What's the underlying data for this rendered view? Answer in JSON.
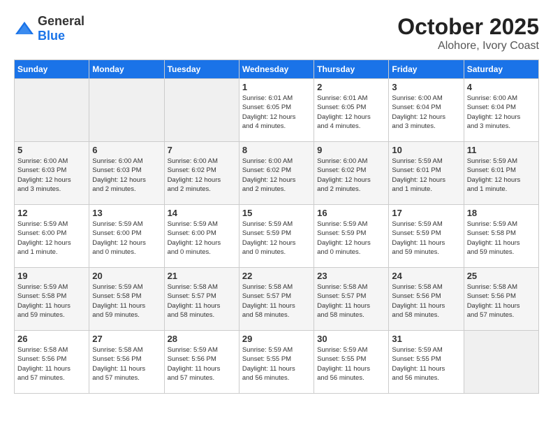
{
  "header": {
    "logo_general": "General",
    "logo_blue": "Blue",
    "month": "October 2025",
    "location": "Alohore, Ivory Coast"
  },
  "days_of_week": [
    "Sunday",
    "Monday",
    "Tuesday",
    "Wednesday",
    "Thursday",
    "Friday",
    "Saturday"
  ],
  "weeks": [
    [
      {
        "day": "",
        "info": ""
      },
      {
        "day": "",
        "info": ""
      },
      {
        "day": "",
        "info": ""
      },
      {
        "day": "1",
        "info": "Sunrise: 6:01 AM\nSunset: 6:05 PM\nDaylight: 12 hours\nand 4 minutes."
      },
      {
        "day": "2",
        "info": "Sunrise: 6:01 AM\nSunset: 6:05 PM\nDaylight: 12 hours\nand 4 minutes."
      },
      {
        "day": "3",
        "info": "Sunrise: 6:00 AM\nSunset: 6:04 PM\nDaylight: 12 hours\nand 3 minutes."
      },
      {
        "day": "4",
        "info": "Sunrise: 6:00 AM\nSunset: 6:04 PM\nDaylight: 12 hours\nand 3 minutes."
      }
    ],
    [
      {
        "day": "5",
        "info": "Sunrise: 6:00 AM\nSunset: 6:03 PM\nDaylight: 12 hours\nand 3 minutes."
      },
      {
        "day": "6",
        "info": "Sunrise: 6:00 AM\nSunset: 6:03 PM\nDaylight: 12 hours\nand 2 minutes."
      },
      {
        "day": "7",
        "info": "Sunrise: 6:00 AM\nSunset: 6:02 PM\nDaylight: 12 hours\nand 2 minutes."
      },
      {
        "day": "8",
        "info": "Sunrise: 6:00 AM\nSunset: 6:02 PM\nDaylight: 12 hours\nand 2 minutes."
      },
      {
        "day": "9",
        "info": "Sunrise: 6:00 AM\nSunset: 6:02 PM\nDaylight: 12 hours\nand 2 minutes."
      },
      {
        "day": "10",
        "info": "Sunrise: 5:59 AM\nSunset: 6:01 PM\nDaylight: 12 hours\nand 1 minute."
      },
      {
        "day": "11",
        "info": "Sunrise: 5:59 AM\nSunset: 6:01 PM\nDaylight: 12 hours\nand 1 minute."
      }
    ],
    [
      {
        "day": "12",
        "info": "Sunrise: 5:59 AM\nSunset: 6:00 PM\nDaylight: 12 hours\nand 1 minute."
      },
      {
        "day": "13",
        "info": "Sunrise: 5:59 AM\nSunset: 6:00 PM\nDaylight: 12 hours\nand 0 minutes."
      },
      {
        "day": "14",
        "info": "Sunrise: 5:59 AM\nSunset: 6:00 PM\nDaylight: 12 hours\nand 0 minutes."
      },
      {
        "day": "15",
        "info": "Sunrise: 5:59 AM\nSunset: 5:59 PM\nDaylight: 12 hours\nand 0 minutes."
      },
      {
        "day": "16",
        "info": "Sunrise: 5:59 AM\nSunset: 5:59 PM\nDaylight: 12 hours\nand 0 minutes."
      },
      {
        "day": "17",
        "info": "Sunrise: 5:59 AM\nSunset: 5:59 PM\nDaylight: 11 hours\nand 59 minutes."
      },
      {
        "day": "18",
        "info": "Sunrise: 5:59 AM\nSunset: 5:58 PM\nDaylight: 11 hours\nand 59 minutes."
      }
    ],
    [
      {
        "day": "19",
        "info": "Sunrise: 5:59 AM\nSunset: 5:58 PM\nDaylight: 11 hours\nand 59 minutes."
      },
      {
        "day": "20",
        "info": "Sunrise: 5:59 AM\nSunset: 5:58 PM\nDaylight: 11 hours\nand 59 minutes."
      },
      {
        "day": "21",
        "info": "Sunrise: 5:58 AM\nSunset: 5:57 PM\nDaylight: 11 hours\nand 58 minutes."
      },
      {
        "day": "22",
        "info": "Sunrise: 5:58 AM\nSunset: 5:57 PM\nDaylight: 11 hours\nand 58 minutes."
      },
      {
        "day": "23",
        "info": "Sunrise: 5:58 AM\nSunset: 5:57 PM\nDaylight: 11 hours\nand 58 minutes."
      },
      {
        "day": "24",
        "info": "Sunrise: 5:58 AM\nSunset: 5:56 PM\nDaylight: 11 hours\nand 58 minutes."
      },
      {
        "day": "25",
        "info": "Sunrise: 5:58 AM\nSunset: 5:56 PM\nDaylight: 11 hours\nand 57 minutes."
      }
    ],
    [
      {
        "day": "26",
        "info": "Sunrise: 5:58 AM\nSunset: 5:56 PM\nDaylight: 11 hours\nand 57 minutes."
      },
      {
        "day": "27",
        "info": "Sunrise: 5:58 AM\nSunset: 5:56 PM\nDaylight: 11 hours\nand 57 minutes."
      },
      {
        "day": "28",
        "info": "Sunrise: 5:59 AM\nSunset: 5:56 PM\nDaylight: 11 hours\nand 57 minutes."
      },
      {
        "day": "29",
        "info": "Sunrise: 5:59 AM\nSunset: 5:55 PM\nDaylight: 11 hours\nand 56 minutes."
      },
      {
        "day": "30",
        "info": "Sunrise: 5:59 AM\nSunset: 5:55 PM\nDaylight: 11 hours\nand 56 minutes."
      },
      {
        "day": "31",
        "info": "Sunrise: 5:59 AM\nSunset: 5:55 PM\nDaylight: 11 hours\nand 56 minutes."
      },
      {
        "day": "",
        "info": ""
      }
    ]
  ]
}
